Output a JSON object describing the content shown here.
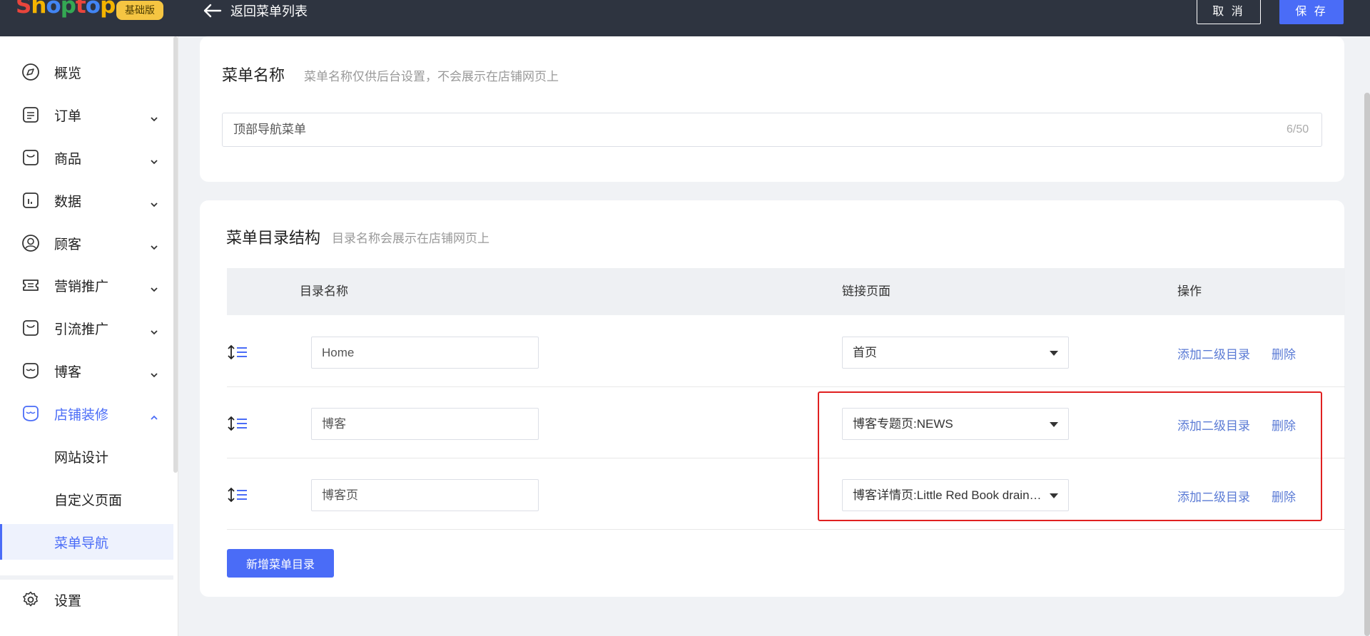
{
  "topbar": {
    "logo_text": "Shoptop",
    "logo_colors": [
      "#e8453c",
      "#f4b400",
      "#4285f4",
      "#34a853",
      "#e8453c",
      "#4285f4",
      "#f4b400"
    ],
    "plan_badge": "基础版",
    "back_label": "返回菜单列表",
    "cancel_label": "取 消",
    "save_label": "保 存"
  },
  "sidebar": {
    "items": [
      {
        "label": "概览",
        "icon": "compass-icon"
      },
      {
        "label": "订单",
        "icon": "order-icon",
        "expandable": true
      },
      {
        "label": "商品",
        "icon": "bag-icon",
        "expandable": true
      },
      {
        "label": "数据",
        "icon": "chart-icon",
        "expandable": true
      },
      {
        "label": "顾客",
        "icon": "user-icon",
        "expandable": true
      },
      {
        "label": "营销推广",
        "icon": "ticket-icon",
        "expandable": true
      },
      {
        "label": "引流推广",
        "icon": "bag-icon",
        "expandable": true
      },
      {
        "label": "博客",
        "icon": "blog-icon",
        "expandable": true
      },
      {
        "label": "店铺装修",
        "icon": "store-icon",
        "expandable": true,
        "expanded": true
      }
    ],
    "sub_items": [
      {
        "label": "网站设计"
      },
      {
        "label": "自定义页面"
      },
      {
        "label": "菜单导航",
        "selected": true
      }
    ],
    "settings_label": "设置"
  },
  "menu_name_card": {
    "title": "菜单名称",
    "hint": "菜单名称仅供后台设置，不会展示在店铺网页上",
    "value": "顶部导航菜单",
    "counter": "6/50"
  },
  "structure_card": {
    "title": "菜单目录结构",
    "hint": "目录名称会展示在店铺网页上",
    "columns": [
      "目录名称",
      "链接页面",
      "操作"
    ],
    "rows": [
      {
        "name": "Home",
        "link": "首页",
        "add_sub": "添加二级目录",
        "delete": "删除"
      },
      {
        "name": "博客",
        "link": "博客专题页:NEWS",
        "add_sub": "添加二级目录",
        "delete": "删除"
      },
      {
        "name": "博客页",
        "link": "博客详情页:Little Red Book drainage",
        "add_sub": "添加二级目录",
        "delete": "删除"
      }
    ],
    "add_button": "新增菜单目录"
  },
  "colors": {
    "accent": "#4a6cf7",
    "topbar": "#2e3440",
    "highlight": "#e02020",
    "link": "#5b7bd5"
  }
}
